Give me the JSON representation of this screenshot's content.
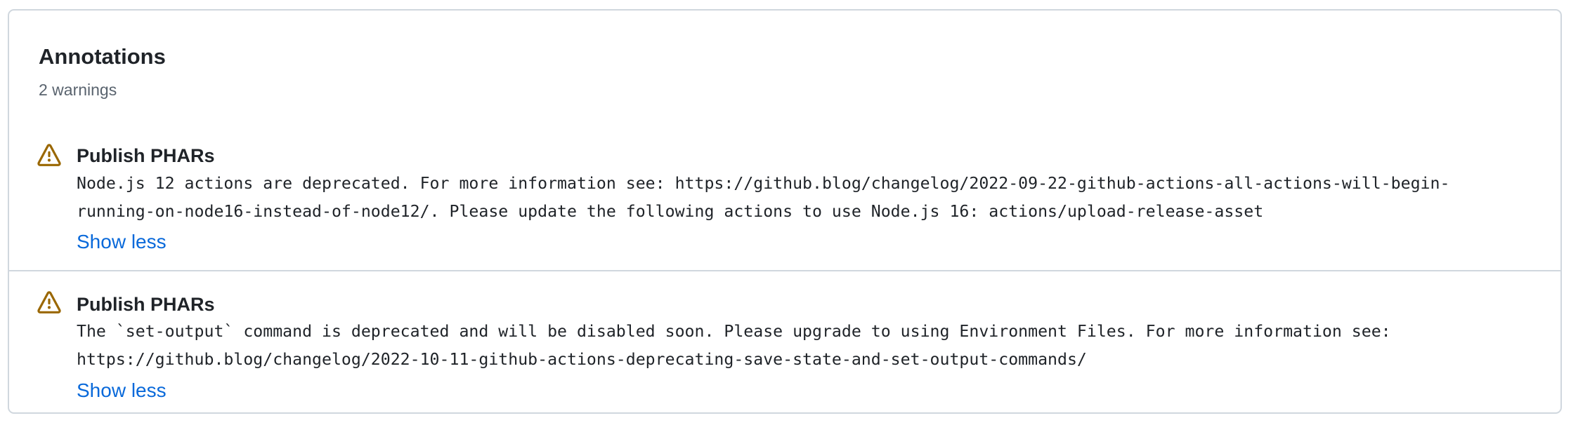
{
  "annotations_panel": {
    "title": "Annotations",
    "subtitle": "2 warnings",
    "items": [
      {
        "icon": "warning-icon",
        "title": "Publish PHARs",
        "message_lines": [
          "Node.js 12 actions are deprecated. For more information see: https://github.blog/changelog/2022-09-22-github-actions-all-actions-will-begin-",
          "running-on-node16-instead-of-node12/. Please update the following actions to use Node.js 16: actions/upload-release-asset"
        ],
        "toggle_label": "Show less"
      },
      {
        "icon": "warning-icon",
        "title": "Publish PHARs",
        "message_lines": [
          "The `set-output` command is deprecated and will be disabled soon. Please upgrade to using Environment Files. For more information see:",
          "https://github.blog/changelog/2022-10-11-github-actions-deprecating-save-state-and-set-output-commands/"
        ],
        "toggle_label": "Show less"
      }
    ]
  },
  "colors": {
    "warning": "#9a6700",
    "link": "#0969da",
    "border": "#d0d7de",
    "muted_text": "#59636e"
  }
}
